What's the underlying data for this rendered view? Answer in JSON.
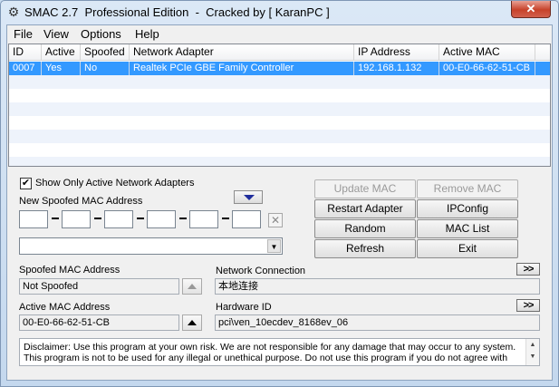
{
  "window": {
    "title": "SMAC 2.7  Professional Edition  -  Cracked by [ KaranPC ]",
    "close_label": "✕"
  },
  "menu": [
    {
      "label": "File"
    },
    {
      "label": "View"
    },
    {
      "label": "Options"
    },
    {
      "label": "Help"
    }
  ],
  "adapters_table": {
    "columns": [
      "ID",
      "Active",
      "Spoofed",
      "Network Adapter",
      "IP Address",
      "Active MAC"
    ],
    "rows": [
      [
        "0007",
        "Yes",
        "No",
        "Realtek PCIe GBE Family Controller",
        "192.168.1.132",
        "00-E0-66-62-51-CB"
      ]
    ]
  },
  "options": {
    "show_only_active_label": "Show Only Active Network Adapters",
    "show_only_active_checked": true,
    "new_mac_label": "New Spoofed MAC Address",
    "mac_octets": [
      "",
      "",
      "",
      "",
      "",
      ""
    ],
    "vendor_select_value": ""
  },
  "buttons": {
    "update_mac": "Update MAC",
    "remove_mac": "Remove MAC",
    "restart_adapter": "Restart Adapter",
    "ipconfig": "IPConfig",
    "random": "Random",
    "mac_list": "MAC List",
    "refresh": "Refresh",
    "exit": "Exit",
    "expand": ">>"
  },
  "info": {
    "spoofed_mac_label": "Spoofed MAC Address",
    "spoofed_mac_value": "Not Spoofed",
    "network_connection_label": "Network Connection",
    "network_connection_value": "本地连接",
    "active_mac_label": "Active MAC Address",
    "active_mac_value": "00-E0-66-62-51-CB",
    "hardware_id_label": "Hardware ID",
    "hardware_id_value": "pci\\ven_10ecdev_8168ev_06"
  },
  "disclaimer": {
    "line1": "Disclaimer: Use this program at your own risk.  We are not responsible for any damage that may occur to any system.",
    "line2": "This program is not to be used for any illegal or unethical purpose.  Do not use this program if you do not agree with"
  },
  "colors": {
    "selection": "#3399ff",
    "close": "#c7422a"
  }
}
